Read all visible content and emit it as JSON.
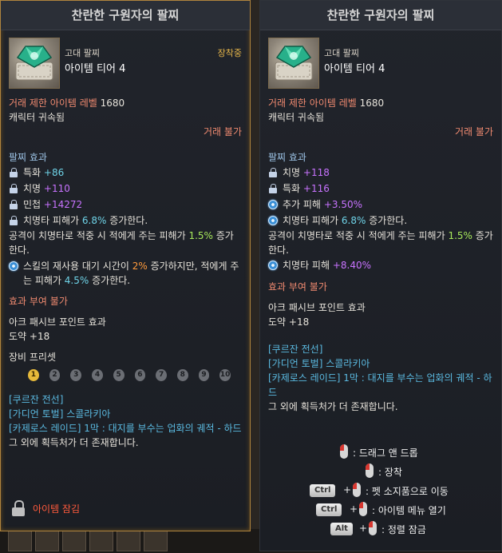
{
  "left": {
    "title": "찬란한 구원자의 팔찌",
    "grade": "고대 팔찌",
    "tier": "아이템 티어 4",
    "equipped": "장착중",
    "trade_level_label": "거래 제한 아이템 레벨",
    "trade_level_value": "1680",
    "bound": "캐릭터 귀속됨",
    "trade": "거래 불가",
    "effect_header": "팔찌 효과",
    "stats": [
      {
        "name": "특화",
        "value": "+86"
      },
      {
        "name": "치명",
        "value": "+110"
      },
      {
        "name": "민첩",
        "value": "+14272"
      }
    ],
    "e1_a": "치명타 피해가 ",
    "e1_b": "6.8%",
    "e1_c": " 증가한다.",
    "e2_a": "공격이 치명타로 적중 시 적에게 주는 피해가 ",
    "e2_b": "1.5%",
    "e2_c": " 증가한다.",
    "e3_a": "스킬의 재사용 대기 시간이 ",
    "e3_b": "2%",
    "e3_c": " 증가하지만, 적에게 주는 피해가 ",
    "e3_d": "4.5%",
    "e3_e": " 증가한다.",
    "no_enchant": "효과 부여 불가",
    "ark_label": "아크 패시브 포인트 효과",
    "ark_value": "도약 +18",
    "preset_label": "장비 프리셋",
    "presets": [
      "1",
      "2",
      "3",
      "4",
      "5",
      "6",
      "7",
      "8",
      "9",
      "10"
    ],
    "sources": [
      "[쿠르잔 전선]",
      "[가디언 토벌] 스콜라키아",
      "[카제로스 레이드] 1막 : 대지를 부수는 업화의 궤적 - 하드",
      "그 외에 획득처가 더 존재합니다."
    ],
    "lock_text": "아이템 잠김"
  },
  "right": {
    "title": "찬란한 구원자의 팔찌",
    "grade": "고대 팔찌",
    "tier": "아이템 티어 4",
    "trade_level_label": "거래 제한 아이템 레벨",
    "trade_level_value": "1680",
    "bound": "캐릭터 귀속됨",
    "trade": "거래 불가",
    "effect_header": "팔찌 효과",
    "stats": [
      {
        "name": "치명",
        "value": "+118"
      },
      {
        "name": "특화",
        "value": "+116"
      }
    ],
    "e1_name": "추가 피해",
    "e1_value": "+3.50%",
    "e2_a": "치명타 피해가 ",
    "e2_b": "6.8%",
    "e2_c": " 증가한다.",
    "e3_a": "공격이 치명타로 적중 시 적에게 주는 피해가 ",
    "e3_b": "1.5%",
    "e3_c": " 증가한다.",
    "e4_name": "치명타 피해",
    "e4_value": "+8.40%",
    "no_enchant": "효과 부여 불가",
    "ark_label": "아크 패시브 포인트 효과",
    "ark_value": "도약 +18",
    "sources": [
      "[쿠르잔 전선]",
      "[가디언 토벌] 스콜라키아",
      "[카제로스 레이드] 1막 : 대지를 부수는 업화의 궤적 - 하드",
      "그 외에 획득처가 더 존재합니다."
    ],
    "hints": {
      "drag": ": 드래그 앤 드롭",
      "equip": ": 장착",
      "ctrl": "Ctrl",
      "pet": ": 펫 소지품으로 이동",
      "menu": ": 아이템 메뉴 열기",
      "alt": "Alt",
      "lock": ": 정렬 잠금",
      "plus": "+"
    }
  },
  "colors": {
    "equipped": "#e8b84a",
    "red_label": "#f08a70",
    "stat_value": "#6fd4e8",
    "purple": "#c873ff",
    "green": "#a7e85b",
    "lock": "#ff5a3c"
  },
  "icons": [
    "bracelet-icon",
    "lock-icon",
    "engraving-icon",
    "mouse-right-icon"
  ]
}
